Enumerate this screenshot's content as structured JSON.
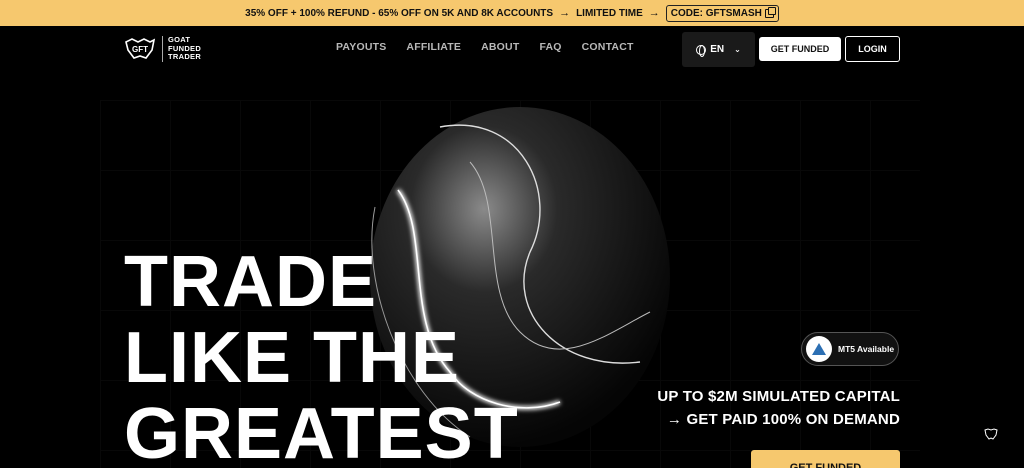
{
  "promo": {
    "offer": "35% OFF + 100% REFUND - 65% OFF ON 5K AND 8K ACCOUNTS",
    "limited": "LIMITED TIME",
    "code": "CODE: GFTSMASH",
    "bg_color": "#f6c86e"
  },
  "brand": {
    "line1": "GOAT",
    "line2": "FUNDED",
    "line3": "TRADER"
  },
  "nav": {
    "items": [
      "PAYOUTS",
      "AFFILIATE",
      "ABOUT",
      "FAQ",
      "CONTACT"
    ],
    "language": "EN",
    "get_funded": "GET FUNDED",
    "login": "LOGIN"
  },
  "hero": {
    "headline_1": "TRADE",
    "headline_2": "LIKE THE",
    "headline_3": "GREATEST",
    "mt5_badge": "MT5 Available",
    "caption_1": "UP TO $2M SIMULATED CAPITAL",
    "caption_2": "GET PAID 100% ON DEMAND",
    "cta": "GET FUNDED"
  },
  "icons": [
    "copy-icon",
    "globe-icon",
    "chevron-down-icon",
    "arrow-right-icon",
    "mt5-icon",
    "gft-logo-icon"
  ]
}
